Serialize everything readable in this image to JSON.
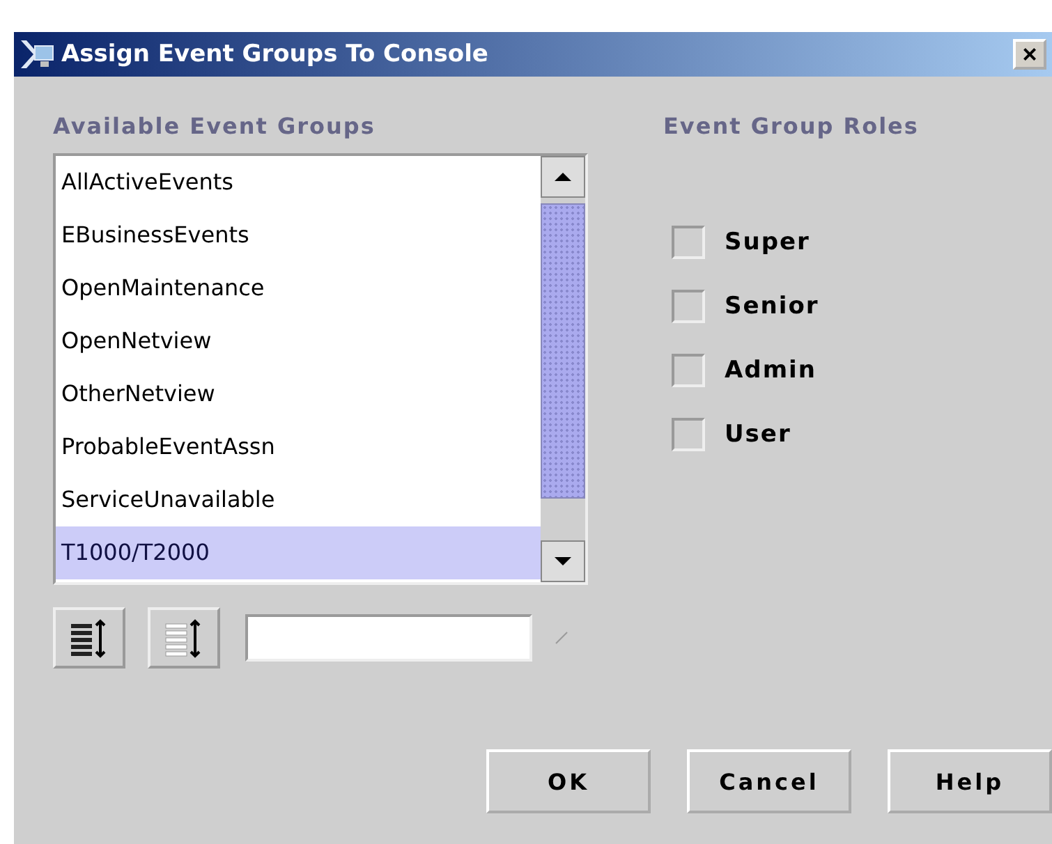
{
  "window": {
    "title": "Assign Event Groups To Console",
    "close": "×"
  },
  "groups": {
    "heading": "Available Event Groups",
    "items": [
      {
        "label": "AllActiveEvents",
        "selected": false
      },
      {
        "label": "EBusinessEvents",
        "selected": false
      },
      {
        "label": "OpenMaintenance",
        "selected": false
      },
      {
        "label": "OpenNetview",
        "selected": false
      },
      {
        "label": "OtherNetview",
        "selected": false
      },
      {
        "label": "ProbableEventAssn",
        "selected": false
      },
      {
        "label": "ServiceUnavailable",
        "selected": false
      },
      {
        "label": "T1000/T2000",
        "selected": true
      }
    ]
  },
  "roles": {
    "heading": "Event Group Roles",
    "items": [
      {
        "label": "Super",
        "checked": false
      },
      {
        "label": "Senior",
        "checked": false
      },
      {
        "label": "Admin",
        "checked": false
      },
      {
        "label": "User",
        "checked": false
      }
    ]
  },
  "buttons": [
    "OK",
    "Cancel",
    "Help"
  ]
}
